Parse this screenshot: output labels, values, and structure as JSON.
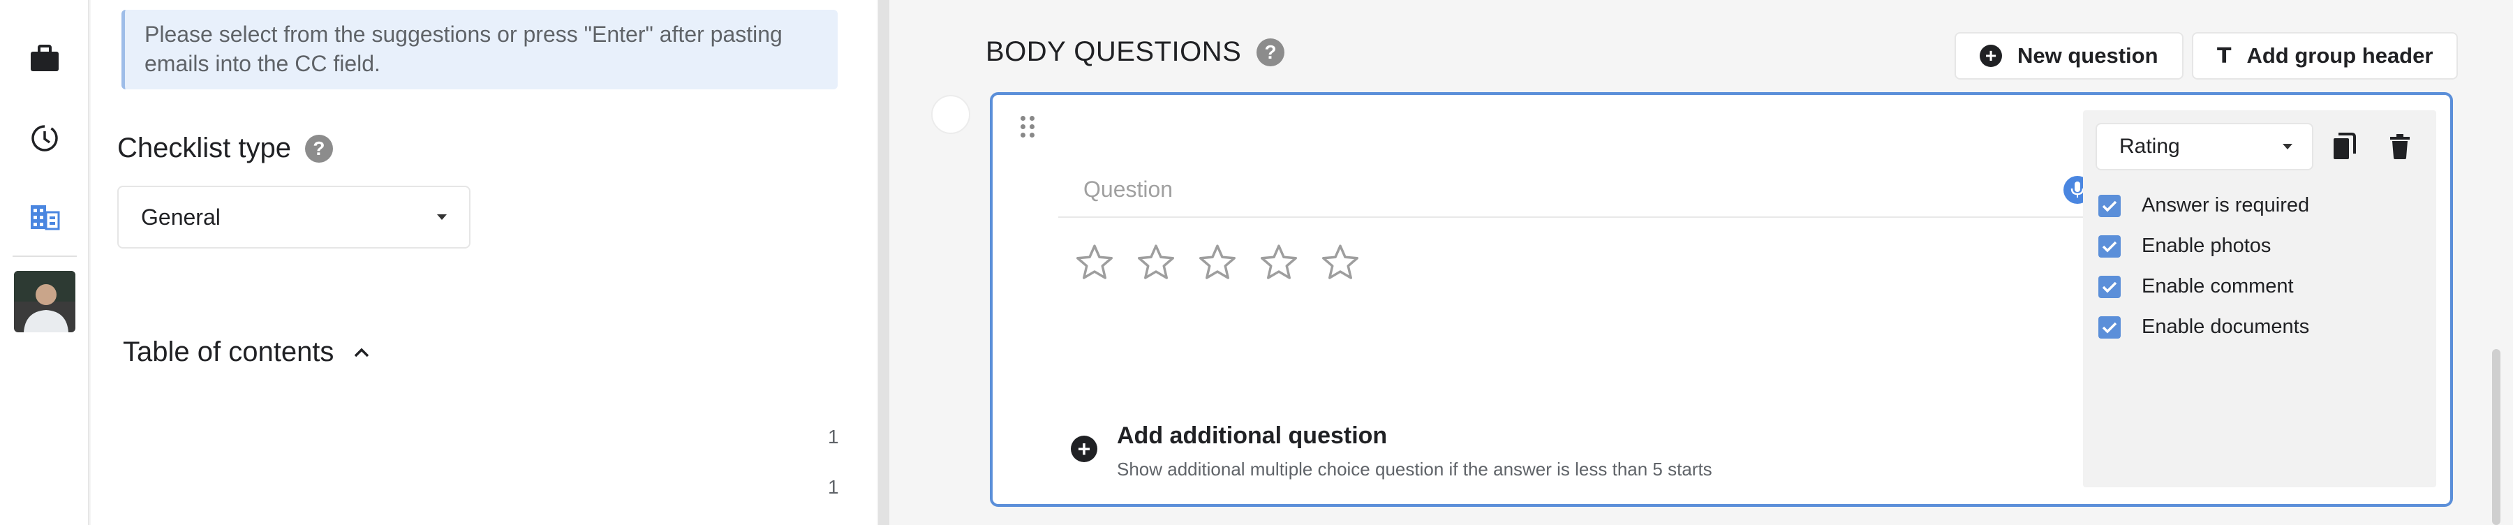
{
  "sidebar": {
    "icons": [
      "briefcase-icon",
      "history-icon",
      "building-icon"
    ],
    "avatar": "user-avatar"
  },
  "panel": {
    "info_text": "Please select from the suggestions or press \"Enter\" after pasting emails into the CC field.",
    "checklist_type_label": "Checklist type",
    "checklist_type_value": "General",
    "toc_label": "Table of contents",
    "toc_counts": [
      "1",
      "1"
    ]
  },
  "main": {
    "section_title": "BODY QUESTIONS",
    "new_question_label": "New question",
    "add_group_header_label": "Add group header",
    "question": {
      "placeholder": "Question",
      "rating_stars": 5,
      "answer_type": "Rating",
      "options": [
        {
          "label": "Answer is required",
          "checked": true
        },
        {
          "label": "Enable photos",
          "checked": true
        },
        {
          "label": "Enable comment",
          "checked": true
        },
        {
          "label": "Enable documents",
          "checked": true
        }
      ],
      "add_additional_title": "Add additional question",
      "add_additional_subtitle": "Show additional multiple choice question if the answer is less than 5 starts"
    }
  },
  "colors": {
    "accent": "#5b8fd9",
    "info_bg": "#e8f0fb",
    "mic": "#4a86e0"
  }
}
